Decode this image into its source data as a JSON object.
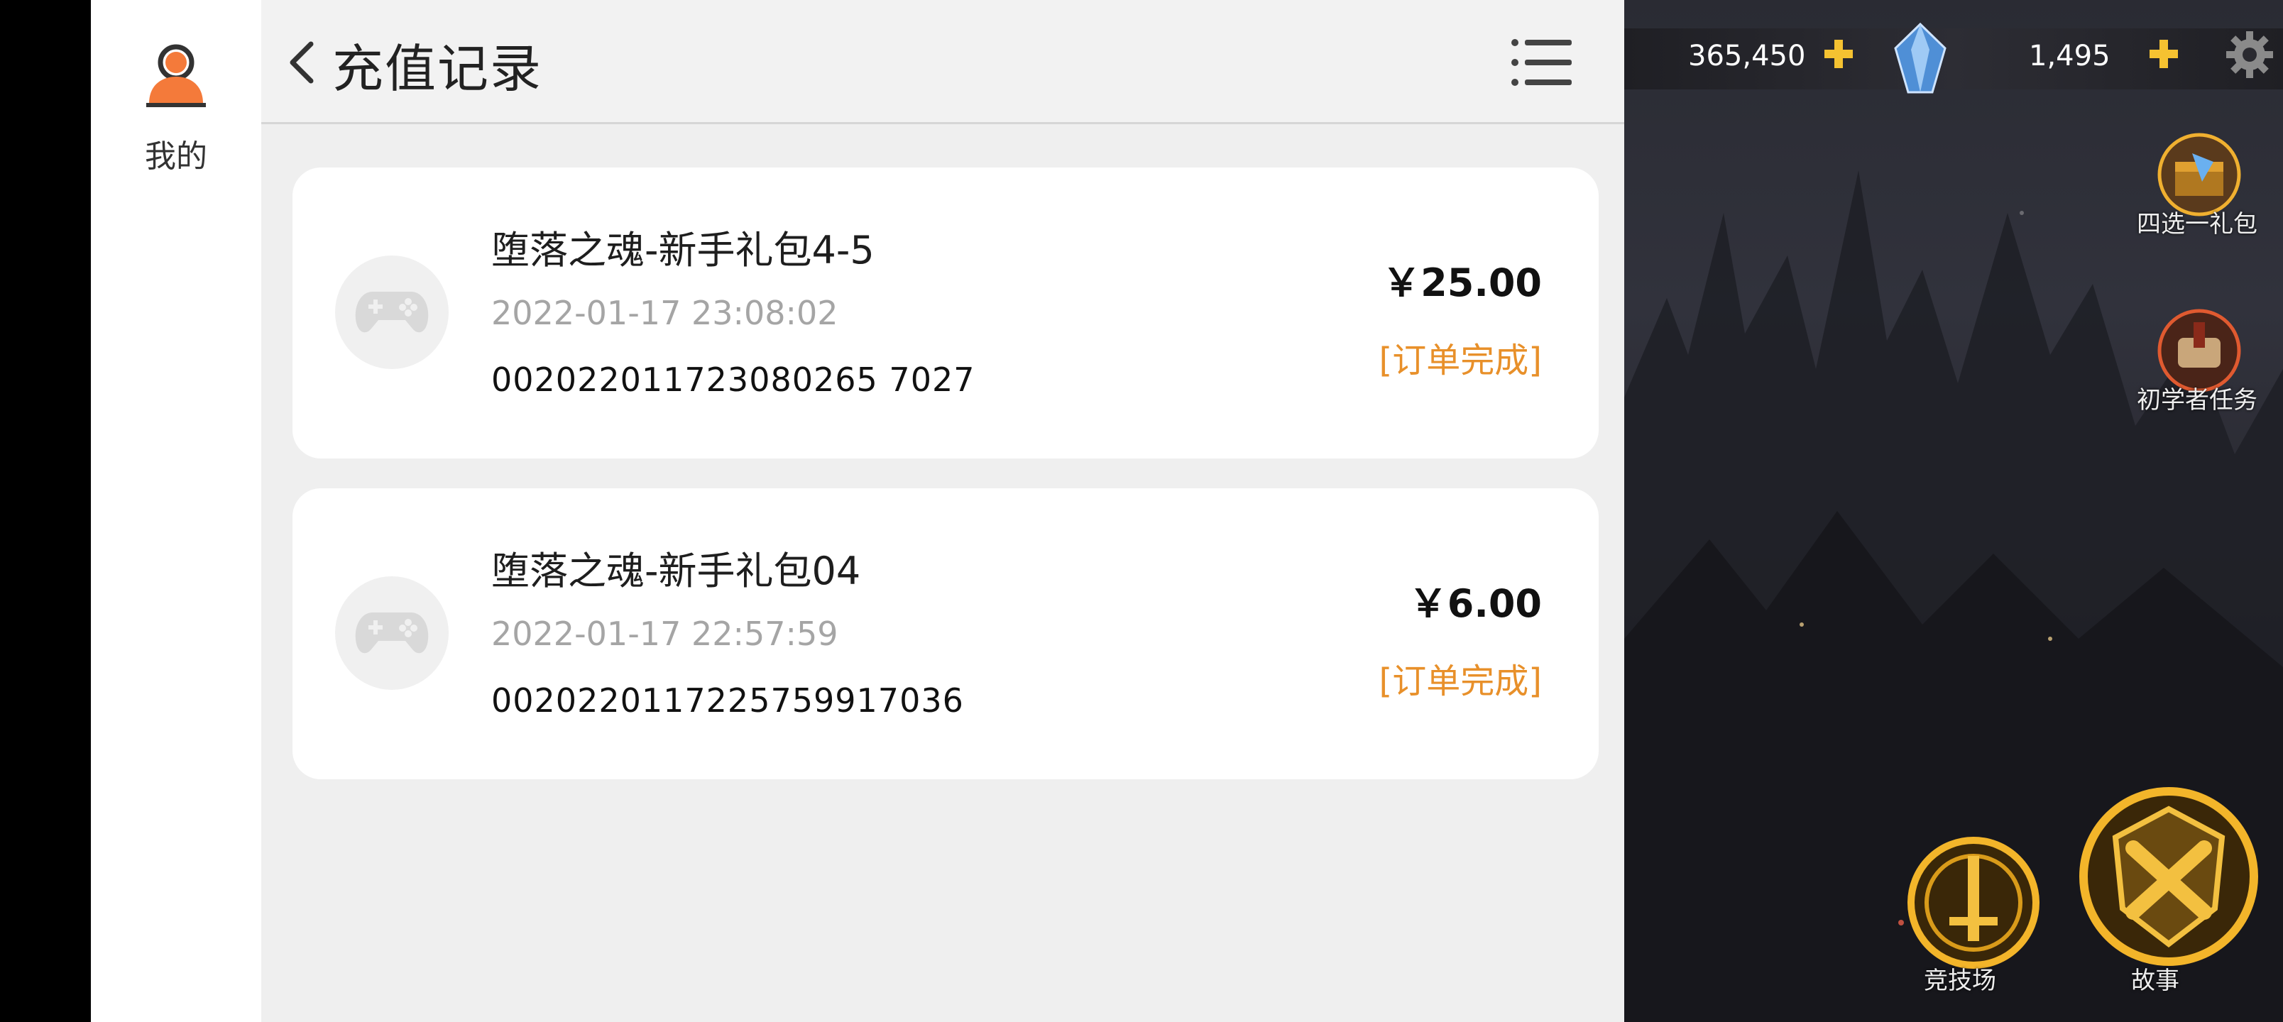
{
  "sidebar": {
    "label": "我的"
  },
  "header": {
    "title": "充值记录"
  },
  "records": [
    {
      "name": "堕落之魂-新手礼包4-5",
      "time": "2022-01-17 23:08:02",
      "order": "002022011723080265 7027",
      "price": "￥25.00",
      "status": "[订单完成]"
    },
    {
      "name": "堕落之魂-新手礼包04",
      "time": "2022-01-17 22:57:59",
      "order": "0020220117225759917036",
      "price": "￥6.00",
      "status": "[订单完成]"
    }
  ],
  "game": {
    "gold": "365,450",
    "gems": "1,495",
    "gift_label": "四选一礼包",
    "task_label": "初学者任务",
    "arena_label": "竞技场",
    "story_label": "故事"
  },
  "colors": {
    "status": "#e8902a",
    "accent_avatar": "#f47a3a"
  },
  "icons": [
    "user-icon",
    "back-chevron-icon",
    "list-menu-icon",
    "gamepad-icon",
    "plus-icon",
    "crystal-gem-icon",
    "gear-icon"
  ]
}
